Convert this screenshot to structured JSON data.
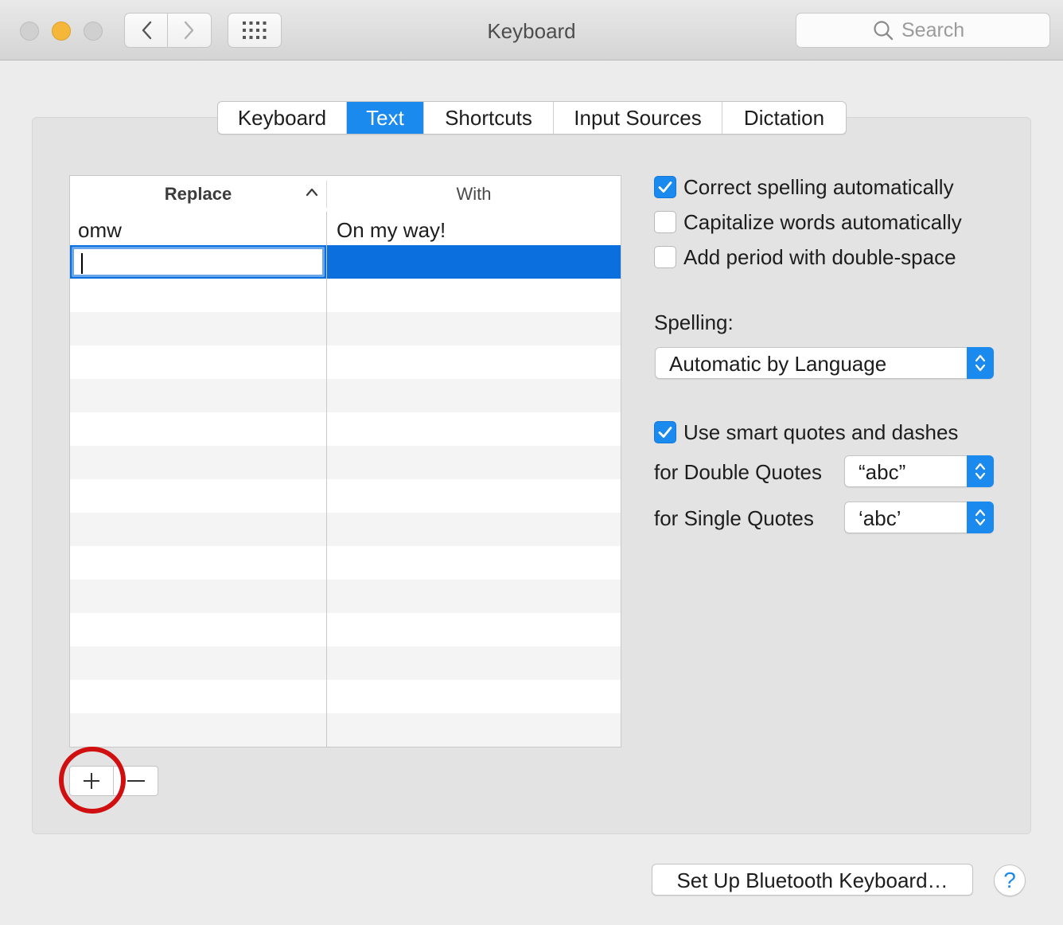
{
  "window": {
    "title": "Keyboard",
    "search_placeholder": "Search"
  },
  "tabs": [
    {
      "label": "Keyboard",
      "selected": false
    },
    {
      "label": "Text",
      "selected": true
    },
    {
      "label": "Shortcuts",
      "selected": false
    },
    {
      "label": "Input Sources",
      "selected": false
    },
    {
      "label": "Dictation",
      "selected": false
    }
  ],
  "table": {
    "columns": {
      "replace": "Replace",
      "with": "With"
    },
    "sort": "ascending",
    "rows": [
      {
        "replace": "omw",
        "with": "On my way!"
      },
      {
        "replace": "",
        "with": "",
        "selected": true,
        "editing": true
      }
    ]
  },
  "buttons": {
    "add": "+",
    "remove": "—"
  },
  "options": {
    "correct_spelling": {
      "label": "Correct spelling automatically",
      "checked": true
    },
    "capitalize_words": {
      "label": "Capitalize words automatically",
      "checked": false
    },
    "add_period": {
      "label": "Add period with double-space",
      "checked": false
    },
    "spelling_label": "Spelling:",
    "spelling_value": "Automatic by Language",
    "smart_quotes": {
      "label": "Use smart quotes and dashes",
      "checked": true
    },
    "double_quotes_label": "for Double Quotes",
    "double_quotes_value": "“abc”",
    "single_quotes_label": "for Single Quotes",
    "single_quotes_value": "‘abc’"
  },
  "footer": {
    "bluetooth_button": "Set Up Bluetooth Keyboard…",
    "help": "?"
  },
  "colors": {
    "accent": "#1a8aef",
    "selection": "#0b6fdd",
    "highlight_ring": "#d01010"
  }
}
